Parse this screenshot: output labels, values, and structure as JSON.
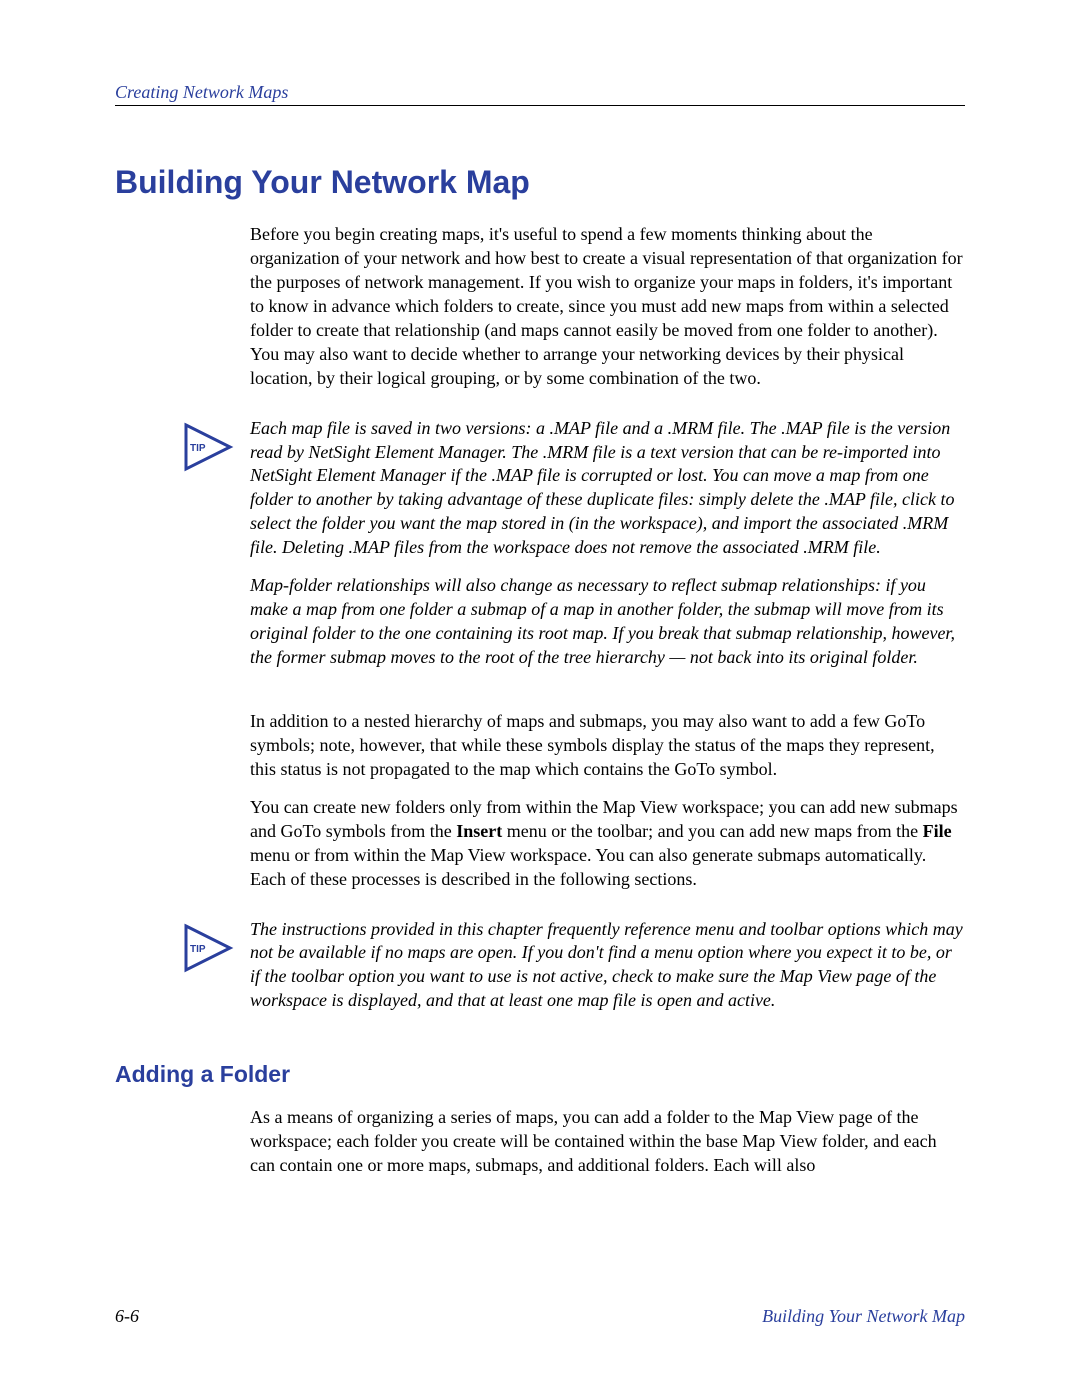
{
  "header": {
    "breadcrumb": "Creating Network Maps"
  },
  "title": "Building Your Network Map",
  "intro": "Before you begin creating maps, it's useful to spend a few moments thinking about the organization of your network and how best to create a visual representation of that organization for the purposes of network management. If you wish to organize your maps in folders, it's important to know in advance which folders to create, since you must add new maps from within a selected folder to create that relationship (and maps cannot easily be moved from one folder to another). You may also want to decide whether to arrange your networking devices by their physical location, by their logical grouping, or by some combination of the two.",
  "tip1": {
    "label": "TIP",
    "p1": "Each map file is saved in two versions: a .MAP file and a .MRM file. The .MAP file is the version read by NetSight Element Manager. The .MRM file is a text version that can be re-imported into NetSight Element Manager if the .MAP file is corrupted or lost. You can move a map from one folder to another by taking advantage of these duplicate files: simply delete the .MAP file, click to select the folder you want the map stored in (in the workspace), and import the associated .MRM file. Deleting .MAP files from the workspace does not remove the associated .MRM file.",
    "p2": "Map-folder relationships will also change as necessary to reflect submap relationships: if you make a map from one folder a submap of a map in another folder, the submap will move from its original folder to the one containing its root map. If you break that submap relationship, however, the former submap moves to the root of the tree hierarchy — not back into its original folder."
  },
  "mid": {
    "p1": "In addition to a nested hierarchy of maps and submaps, you may also want to add a few GoTo symbols; note, however, that while these symbols display the status of the maps they represent, this status is not propagated to the map which contains the GoTo symbol.",
    "p2_pre": "You can create new folders only from within the Map View workspace; you can add new submaps and GoTo symbols from the ",
    "p2_b1": "Insert",
    "p2_mid": " menu or the toolbar; and you can add new maps from the ",
    "p2_b2": "File",
    "p2_post": " menu or from within the Map View workspace. You can also generate submaps automatically. Each of these processes is described in the following sections."
  },
  "tip2": {
    "label": "TIP",
    "p1": "The instructions provided in this chapter frequently reference menu and toolbar options which may not be available if no maps are open. If you don't find a menu option where you expect it to be, or if the toolbar option you want to use is not active, check to make sure the Map View page of the workspace is displayed, and that at least one map file is open and active."
  },
  "subsection": {
    "title": "Adding a Folder",
    "p1": "As a means of organizing a series of maps, you can add a folder to the Map View page of the workspace; each folder you create will be contained within the base Map View folder, and each can contain one or more maps, submaps, and additional folders. Each will also"
  },
  "footer": {
    "page": "6-6",
    "section": "Building Your Network Map"
  }
}
